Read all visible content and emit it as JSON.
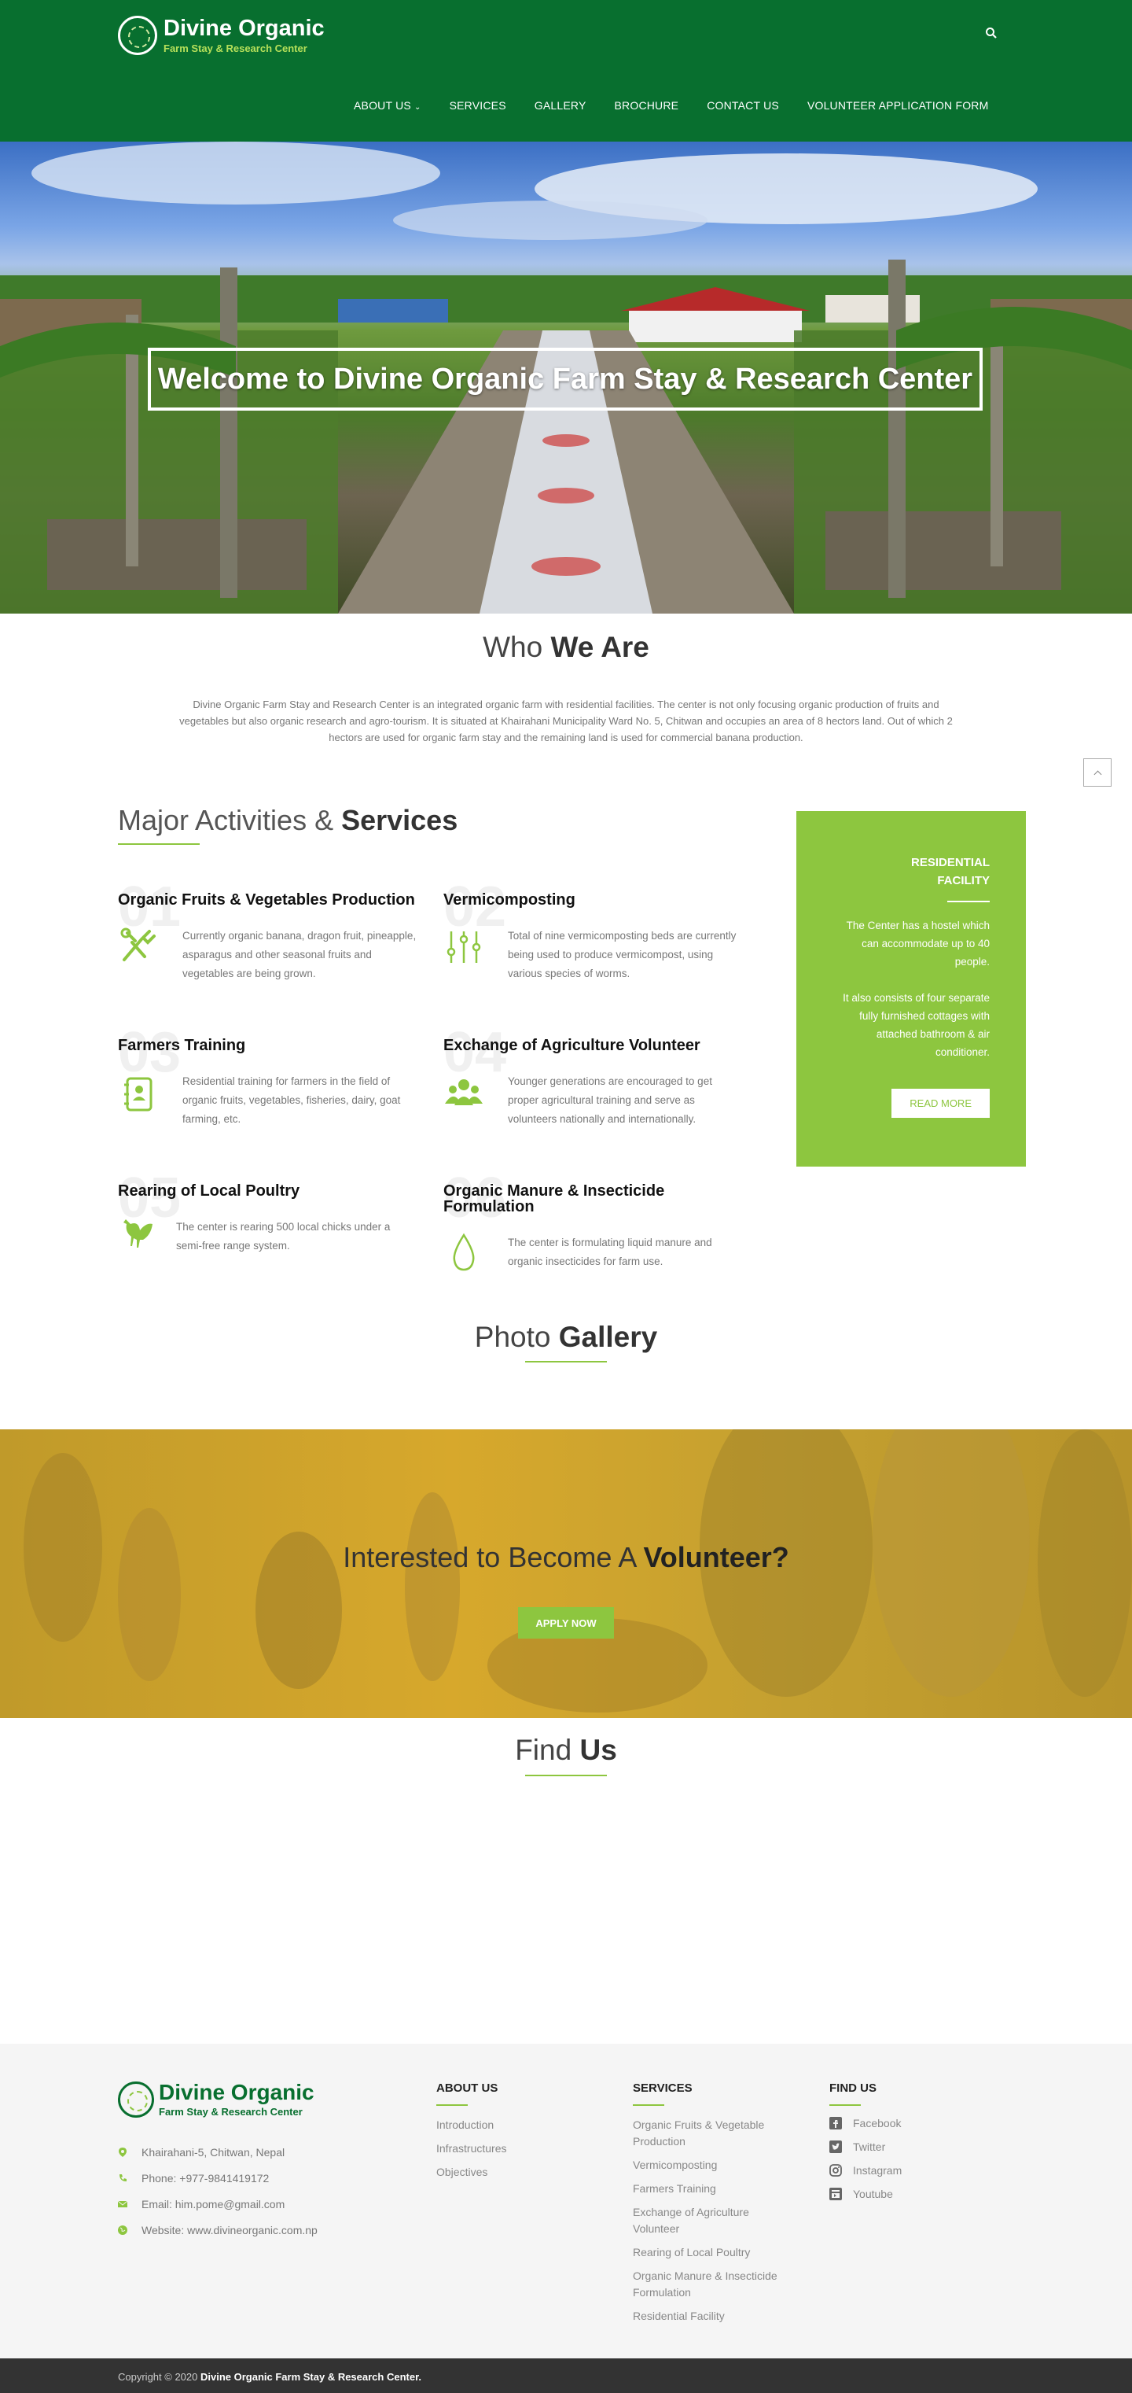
{
  "header": {
    "logo_title": "Divine Organic",
    "logo_subtitle": "Farm Stay & Research Center",
    "nav": [
      "ABOUT US",
      "SERVICES",
      "GALLERY",
      "BROCHURE",
      "CONTACT US",
      "VOLUNTEER APPLICATION FORM"
    ],
    "search_icon": "search-icon"
  },
  "hero": {
    "title": "Welcome to Divine Organic Farm Stay & Research Center"
  },
  "who": {
    "title_light": "Who",
    "title_bold": "We Are",
    "text": "Divine Organic Farm Stay and Research Center is an integrated organic farm with residential facilities. The center is not only focusing organic production of fruits and vegetables but also organic research and agro-tourism. It is situated at Khairahani Municipality Ward No. 5, Chitwan and occupies an area of 8 hectors land. Out of which 2 hectors are used for organic farm stay and the remaining  land is used for commercial banana production."
  },
  "activities": {
    "title_light": "Major Activities &",
    "title_bold": "Services",
    "items": [
      {
        "num": "01",
        "title": "Organic Fruits & Vegetables Production",
        "desc": "Currently organic banana, dragon fruit, pineapple, asparagus and other seasonal fruits and vegetables are being grown.",
        "icon": "tools-icon"
      },
      {
        "num": "02",
        "title": "Vermicomposting",
        "desc": "Total of nine vermicomposting beds are currently being used to produce vermicompost, using various species of worms.",
        "icon": "sliders-icon"
      },
      {
        "num": "03",
        "title": "Farmers Training",
        "desc": "Residential training for farmers in the field of organic fruits, vegetables, fisheries, dairy, goat farming, etc.",
        "icon": "contact-book-icon"
      },
      {
        "num": "04",
        "title": "Exchange of Agriculture Volunteer",
        "desc": "Younger generations are encouraged to get proper agricultural training and serve as volunteers nationally and internationally.",
        "icon": "people-icon"
      },
      {
        "num": "05",
        "title": "Rearing of Local Poultry",
        "desc": "The center is rearing 500 local chicks under a semi-free range system.",
        "icon": "chicken-icon"
      },
      {
        "num": "06",
        "title": "Organic Manure & Insecticide Formulation",
        "desc": "The center is formulating liquid manure and organic insecticides for farm use.",
        "icon": "drop-icon"
      }
    ]
  },
  "residential": {
    "title": "RESIDENTIAL FACILITY",
    "p1": "The Center has a hostel which can accommodate up to 40 people.",
    "p2": "It also consists of four separate fully furnished cottages with attached bathroom & air conditioner.",
    "button": "READ MORE"
  },
  "gallery": {
    "title_light": "Photo",
    "title_bold": "Gallery"
  },
  "volunteer": {
    "title_light": "Interested to Become A",
    "title_bold": "Volunteer?",
    "button": "APPLY NOW"
  },
  "find": {
    "title_light": "Find",
    "title_bold": "Us"
  },
  "footer": {
    "logo_title": "Divine Organic",
    "logo_subtitle": "Farm Stay & Research Center",
    "contact": [
      {
        "icon": "map-marker-icon",
        "text": "Khairahani-5, Chitwan, Nepal"
      },
      {
        "icon": "phone-icon",
        "text": "Phone: +977-9841419172"
      },
      {
        "icon": "envelope-icon",
        "text": "Email: him.pome@gmail.com"
      },
      {
        "icon": "globe-icon",
        "text": "Website: www.divineorganic.com.np"
      }
    ],
    "about_title": "ABOUT US",
    "about_links": [
      "Introduction",
      "Infrastructures",
      "Objectives"
    ],
    "services_title": "SERVICES",
    "services_links": [
      "Organic Fruits & Vegetable Production",
      "Vermicomposting",
      "Farmers Training",
      "Exchange of Agriculture Volunteer",
      "Rearing of Local Poultry",
      "Organic Manure & Insecticide Formulation",
      "Residential Facility"
    ],
    "find_title": "FIND US",
    "social": [
      {
        "icon": "facebook-icon",
        "label": "Facebook"
      },
      {
        "icon": "twitter-icon",
        "label": "Twitter"
      },
      {
        "icon": "instagram-icon",
        "label": "Instagram"
      },
      {
        "icon": "youtube-icon",
        "label": "Youtube"
      }
    ],
    "copyright_prefix": "Copyright © 2020",
    "copyright_name": "Divine Organic Farm Stay & Research Center."
  },
  "colors": {
    "header_green": "#086f2f",
    "accent_green": "#8dc63f",
    "footer_bg": "#f5f5f5",
    "copyright_bg": "#333333"
  }
}
